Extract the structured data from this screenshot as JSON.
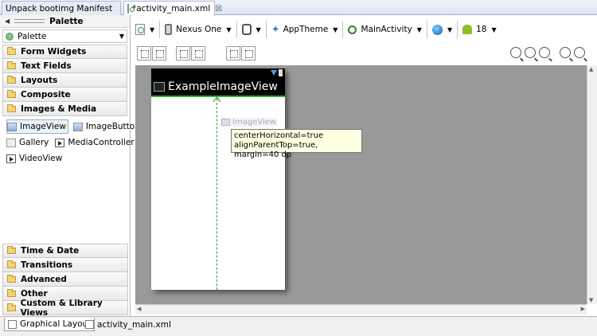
{
  "editor_tabs": [
    {
      "label": "Unpack bootimg Manifest"
    },
    {
      "label": "*activity_main.xml",
      "close": "☒"
    }
  ],
  "palette": {
    "header": "Palette",
    "selector_value": "Palette",
    "categories_top": [
      "Form Widgets",
      "Text Fields",
      "Layouts",
      "Composite",
      "Images & Media"
    ],
    "items": [
      "ImageView",
      "ImageButton",
      "Gallery",
      "MediaController",
      "VideoView"
    ],
    "categories_bottom": [
      "Time & Date",
      "Transitions",
      "Advanced",
      "Other",
      "Custom & Library Views"
    ]
  },
  "toolbar": {
    "device": "Nexus One",
    "theme": "AppTheme",
    "activity": "MainActivity",
    "api_level": "18"
  },
  "canvas": {
    "app_title": "ExampleImageView",
    "ghost_label": "ImageView",
    "tooltip_line1": "centerHorizontal=true",
    "tooltip_line2": "alignParentTop=true, margin=40 dp"
  },
  "bottom_tabs": [
    "Graphical Layout",
    "activity_main.xml"
  ],
  "colors": {
    "accent_green": "#33b033",
    "canvas_bg": "#999999",
    "tooltip_bg": "#ffffe1"
  }
}
